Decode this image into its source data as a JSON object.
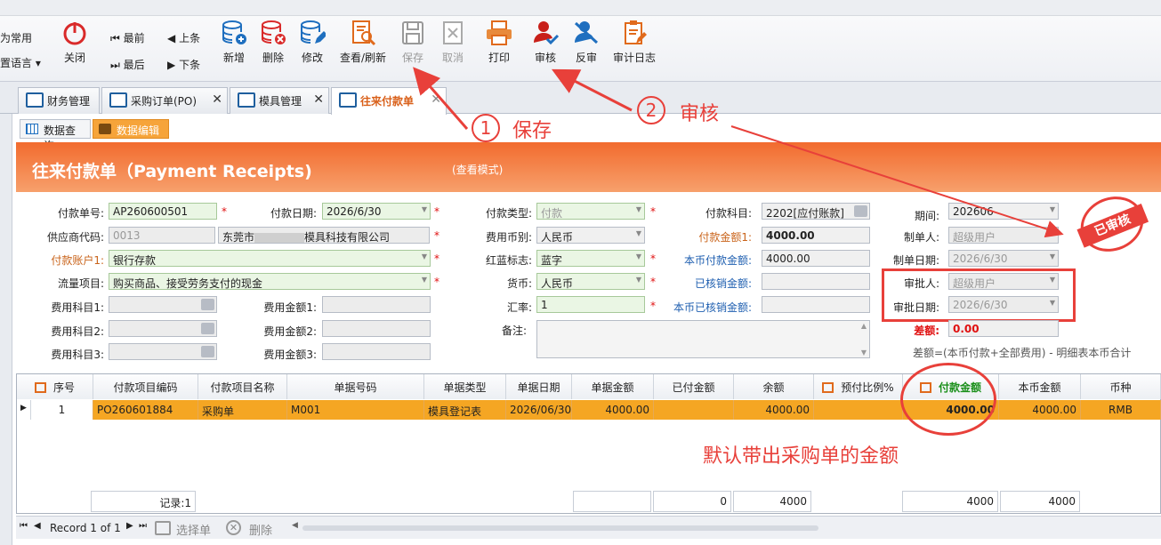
{
  "toolbar": {
    "left_top": "为常用",
    "left_bottom": "置语言",
    "close": "关闭",
    "first": "最前",
    "last": "最后",
    "prev": "上条",
    "next": "下条",
    "add": "新增",
    "delete": "删除",
    "edit": "修改",
    "view_refresh": "查看/刷新",
    "save": "保存",
    "cancel": "取消",
    "print": "打印",
    "audit": "审核",
    "unaudit": "反审",
    "audit_log": "审计日志"
  },
  "tabs": [
    "财务管理",
    "采购订单(PO)",
    "模具管理",
    "往来付款单"
  ],
  "subtabs": [
    "数据查询",
    "数据编辑"
  ],
  "form": {
    "title": "往来付款单（Payment Receipts)",
    "mode": "(查看模式)",
    "labels": {
      "pay_no": "付款单号:",
      "supplier_code": "供应商代码:",
      "pay_account": "付款账户1:",
      "flow_item": "流量项目:",
      "fee_subj1": "费用科目1:",
      "fee_subj2": "费用科目2:",
      "fee_subj3": "费用科目3:",
      "pay_date": "付款日期:",
      "fee_amt1": "费用金额1:",
      "fee_amt2": "费用金额2:",
      "fee_amt3": "费用金额3:",
      "pay_type": "付款类型:",
      "fee_currency": "费用币别:",
      "red_blue": "红蓝标志:",
      "currency": "货币:",
      "rate": "汇率:",
      "remark": "备注:",
      "pay_subject": "付款科目:",
      "pay_amount": "付款金额1:",
      "local_amount": "本币付款金额:",
      "verified": "已核销金额:",
      "local_verified": "本币已核销金额:",
      "period": "期间:",
      "maker": "制单人:",
      "make_date": "制单日期:",
      "approver": "审批人:",
      "approve_date": "审批日期:",
      "diff": "差额:",
      "diff_note": "差额=(本币付款+全部费用) - 明细表本币合计"
    },
    "values": {
      "pay_no": "AP260600501",
      "supplier_code": "0013",
      "supplier_name": "东莞市",
      "supplier_name_rest": "模具科技有限公司",
      "pay_account": "银行存款",
      "flow_item": "购买商品、接受劳务支付的现金",
      "pay_date": "2026/6/30",
      "pay_type": "付款",
      "fee_currency": "人民币",
      "red_blue": "蓝字",
      "currency": "人民币",
      "rate": "1",
      "pay_subject": "2202[应付账款]",
      "pay_amount": "4000.00",
      "local_amount": "4000.00",
      "period": "202606",
      "maker": "超级用户",
      "make_date": "2026/6/30",
      "approver": "超级用户",
      "approve_date": "2026/6/30",
      "diff": "0.00"
    },
    "stamp": "已审核"
  },
  "grid": {
    "headers": [
      "序号",
      "付款项目编码",
      "付款项目名称",
      "单据号码",
      "单据类型",
      "单据日期",
      "单据金额",
      "已付金额",
      "余额",
      "预付比例%",
      "付款金额",
      "本币金额",
      "币种"
    ],
    "rows": [
      [
        "1",
        "PO260601884",
        "采购单",
        "M001",
        "模具登记表",
        "2026/06/30",
        "4000.00",
        "",
        "4000.00",
        "",
        "4000.00",
        "4000.00",
        "RMB"
      ]
    ],
    "footer": {
      "records": "记录:1",
      "paid": "0",
      "balance": "4000",
      "pay": "4000",
      "local": "4000"
    }
  },
  "navbar": {
    "record": "Record 1 of 1",
    "select": "选择单",
    "delete": "删除"
  },
  "annotations": {
    "save_num": "1",
    "save_text": "保存",
    "audit_num": "2",
    "audit_text": "审核",
    "note": "默认带出采购单的金额"
  },
  "colors": {
    "accent": "#f26b2e",
    "highlight_row": "#f5a623",
    "annotation": "#e8403a"
  }
}
